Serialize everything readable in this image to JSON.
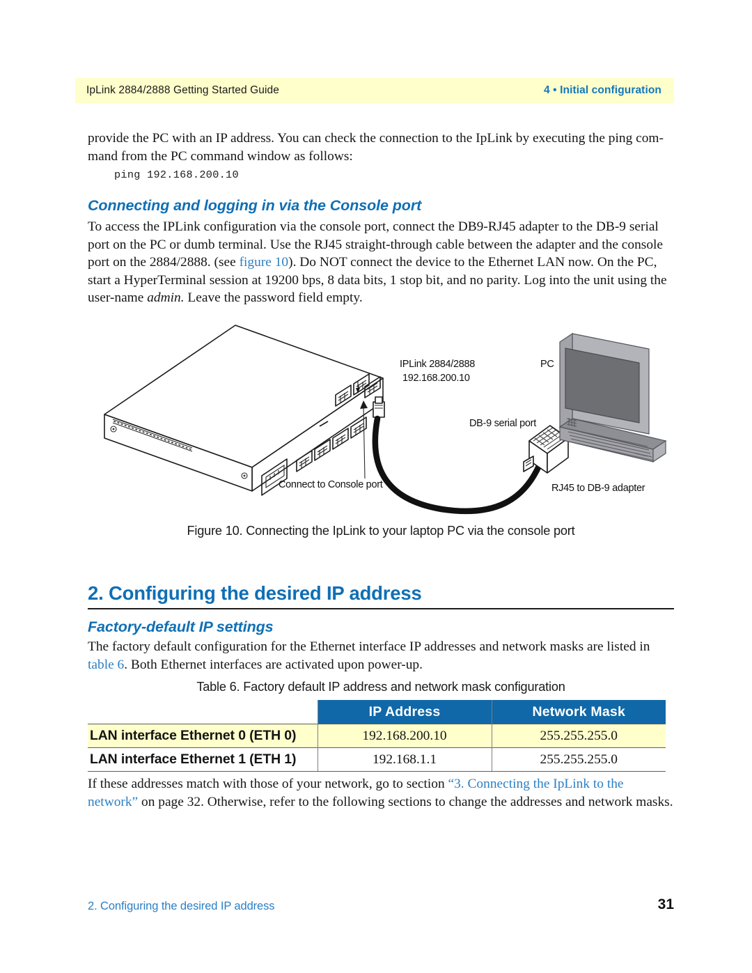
{
  "header": {
    "left": "IpLink 2884/2888 Getting Started Guide",
    "right": "4 • Initial configuration",
    "band_color": "#ffffcc",
    "accent_color": "#1577bd"
  },
  "body": {
    "intro_paragraph": "provide the PC with an IP address. You can check the connection to the IpLink by executing the ping com-mand from the PC command window as follows:",
    "code_line": "ping 192.168.200.10",
    "console_heading": "Connecting and logging in via the Console port",
    "console_paragraph_1": "To access the IPLink configuration via the console port, connect the DB9-RJ45 adapter to the DB-9 serial port on the PC or dumb terminal. Use the RJ45 straight-through cable between the adapter and the console port on the 2884/2888. (see ",
    "console_link": "figure 10",
    "console_paragraph_2": "). Do NOT connect the device to the Ethernet LAN now. On the PC, start a HyperTerminal session at 19200 bps, 8 data bits, 1 stop bit, and no parity. Log into the unit using the user-name ",
    "console_italic": "admin.",
    "console_paragraph_3": " Leave the password field empty."
  },
  "figure": {
    "caption": "Figure 10. Connecting the IpLink to your laptop PC via the console port",
    "labels": {
      "device_name": "IPLink 2884/2888",
      "device_ip": "192.168.200.10",
      "pc": "PC",
      "db9_serial_port": "DB-9 serial port",
      "connect_console": "Connect to Console port",
      "rj45_adapter": "RJ45 to DB-9 adapter"
    },
    "colors": {
      "laptop_body": "#9a9aa0",
      "laptop_screen": "#6d6f73",
      "cable": "#111111",
      "outline": "#1b1b1b"
    }
  },
  "section": {
    "title": "2. Configuring the desired IP address",
    "subheading": "Factory-default IP settings",
    "paragraph_1": "The factory default configuration for the Ethernet interface IP addresses and network masks are listed in ",
    "paragraph_1_link": "table 6",
    "paragraph_1_end": ". Both Ethernet interfaces are activated upon power-up."
  },
  "table": {
    "caption": "Table 6. Factory default IP address and network mask configuration",
    "header_color": "#1068a8",
    "tint_color": "#ffffcc",
    "columns": [
      "",
      "IP Address",
      "Network Mask"
    ],
    "rows": [
      {
        "label": "LAN interface Ethernet 0 (ETH 0)",
        "ip_address": "192.168.200.10",
        "network_mask": "255.255.255.0",
        "tinted": true
      },
      {
        "label": "LAN interface Ethernet 1 (ETH 1)",
        "ip_address": "192.168.1.1",
        "network_mask": "255.255.255.0",
        "tinted": false
      }
    ]
  },
  "closing": {
    "text_1": "If these addresses match with those of your network, go to section ",
    "link": "“3. Connecting the IpLink to the network”",
    "text_2": " on page 32. Otherwise, refer to the following sections to change the addresses and network masks."
  },
  "footer": {
    "left": "2. Configuring the desired IP address",
    "page_number": "31"
  }
}
